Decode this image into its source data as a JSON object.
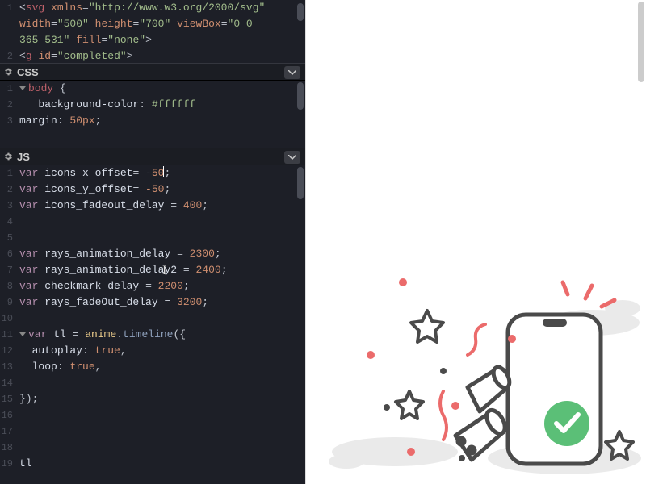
{
  "panes": {
    "css": {
      "label": "CSS"
    },
    "js": {
      "label": "JS"
    }
  },
  "html_code": {
    "lines": [
      "1",
      "2"
    ],
    "l1a": "<",
    "l1b": "svg",
    "l1c": " ",
    "l1d": "xmlns",
    "l1e": "=",
    "l1f": "\"http://www.w3.org/2000/svg\"",
    "l2a": "width",
    "l2b": "=",
    "l2c": "\"500\"",
    "l2d": " ",
    "l2e": "height",
    "l2f": "=",
    "l2g": "\"700\"",
    "l2h": " ",
    "l2i": "viewBox",
    "l2j": "=",
    "l2k": "\"0 0",
    "l3a": "365 531\"",
    "l3b": " ",
    "l3c": "fill",
    "l3d": "=",
    "l3e": "\"none\"",
    "l3f": ">",
    "l4a": "<",
    "l4b": "g",
    "l4c": " ",
    "l4d": "id",
    "l4e": "=",
    "l4f": "\"completed\"",
    "l4g": ">"
  },
  "css_code": {
    "lines": [
      "1",
      "2",
      "3"
    ],
    "sel": "body",
    "br": " {",
    "p1n": "background-color",
    "p1c": ": ",
    "p1v": "#ffffff",
    "p2n": "margin",
    "p2c": ": ",
    "p2v": "50px",
    "sc": ";",
    "close": ""
  },
  "js_code": {
    "lines": [
      "1",
      "2",
      "3",
      "4",
      "5",
      "6",
      "7",
      "8",
      "9",
      "10",
      "11",
      "12",
      "13",
      "14",
      "15",
      "16",
      "17",
      "18",
      "19"
    ],
    "var": "var",
    "l1i": "icons_x_offset",
    "eq": "= ",
    "neg": "-",
    "n50": "50",
    "sc": ";",
    "l2i": "icons_y_offset",
    "nn50": "-50",
    "l3i": "icons_fadeout_delay",
    "n400": "400",
    "l6i": "rays_animation_delay",
    "n2300": "2300",
    "l7i": "rays_animation_delay2",
    "n2400": "2400",
    "l8i": "checkmark_delay",
    "n2200": "2200",
    "l9i": "rays_fadeOut_delay",
    "n3200": "3200",
    "l11i": "tl",
    "l11o": "anime",
    "dot": ".",
    "l11f": "timeline",
    "op": "(",
    "obr": "({",
    "l12p": "autoplay",
    "colon": ": ",
    "true": "true",
    "comma": ",",
    "l13p": "loop",
    "cbr": "});",
    "l19": "tl"
  }
}
